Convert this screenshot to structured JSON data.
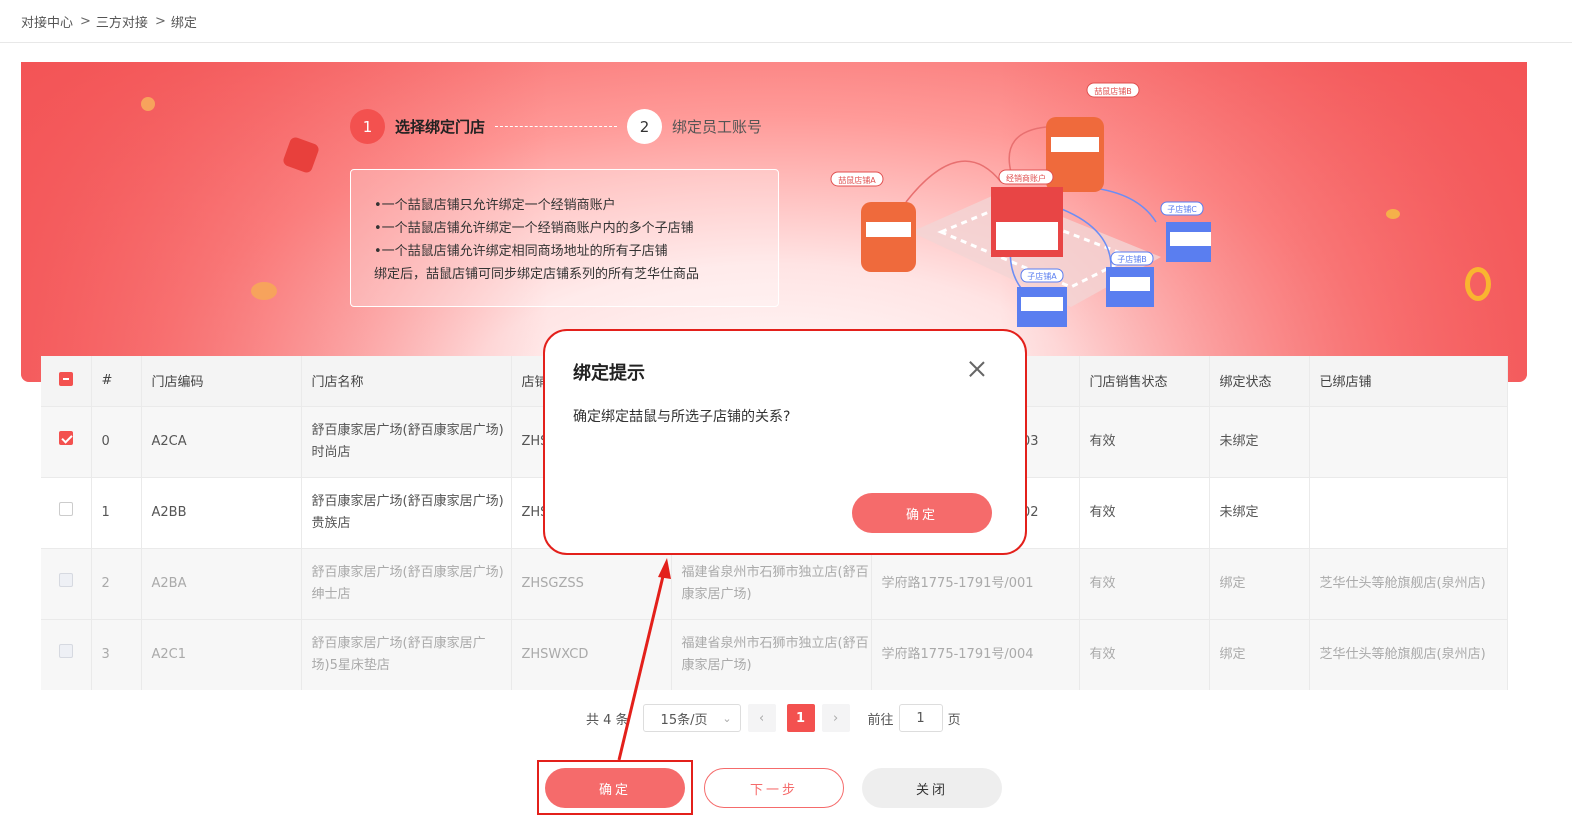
{
  "breadcrumb": [
    "对接中心",
    "三方对接",
    "绑定"
  ],
  "steps": [
    {
      "num": "1",
      "label": "选择绑定门店",
      "active": true
    },
    {
      "num": "2",
      "label": "绑定员工账号",
      "active": false
    }
  ],
  "info_lines": [
    "•一个喆鼠店铺只允许绑定一个经销商账户",
    "•一个喆鼠店铺允许绑定一个经销商账户内的多个子店铺",
    "•一个喆鼠店铺允许绑定相同商场地址的所有子店铺",
    "绑定后，喆鼠店铺可同步绑定店铺系列的所有芝华仕商品"
  ],
  "illustration_labels": {
    "store_a": "喆鼠店铺A",
    "store_b": "喆鼠店铺B",
    "dealer": "经销商账户",
    "sub_a": "子店铺A",
    "sub_b": "子店铺B",
    "sub_c": "子店铺C"
  },
  "table": {
    "headers": [
      "",
      "#",
      "门店编码",
      "门店名称",
      "店铺",
      "",
      "",
      "门店销售状态",
      "绑定状态",
      "已绑店铺"
    ],
    "rows": [
      {
        "checked": "checked",
        "state": "active",
        "cells": [
          "0",
          "A2CA",
          "舒百康家居广场(舒百康家居广场)时尚店",
          "ZHS",
          "",
          "003",
          "有效",
          "未绑定",
          ""
        ]
      },
      {
        "checked": "unchecked",
        "state": "normal",
        "cells": [
          "1",
          "A2BB",
          "舒百康家居广场(舒百康家居广场)贵族店",
          "ZHS",
          "",
          "02",
          "有效",
          "未绑定",
          ""
        ]
      },
      {
        "checked": "disabled",
        "state": "disabled",
        "cells": [
          "2",
          "A2BA",
          "舒百康家居广场(舒百康家居广场)绅士店",
          "ZHSGZSS",
          "福建省泉州市石狮市独立店(舒百康家居广场)",
          "学府路1775-1791号/001",
          "有效",
          "绑定",
          "芝华仕头等舱旗舰店(泉州店)"
        ]
      },
      {
        "checked": "disabled",
        "state": "disabled",
        "cells": [
          "3",
          "A2C1",
          "舒百康家居广场(舒百康家居广场)5星床垫店",
          "ZHSWXCD",
          "福建省泉州市石狮市独立店(舒百康家居广场)",
          "学府路1775-1791号/004",
          "有效",
          "绑定",
          "芝华仕头等舱旗舰店(泉州店)"
        ]
      }
    ]
  },
  "pager": {
    "total": "共 4 条",
    "size": "15条/页",
    "current": "1",
    "goto_label": "前往",
    "goto_value": "1",
    "page_unit": "页"
  },
  "buttons": {
    "confirm": "确定",
    "next": "下一步",
    "close": "关闭"
  },
  "modal": {
    "title": "绑定提示",
    "text": "确定绑定喆鼠与所选子店铺的关系?",
    "confirm": "确定"
  },
  "colors": {
    "accent": "#f3514f",
    "button": "#f56b6b",
    "annotation": "#e3201b"
  }
}
